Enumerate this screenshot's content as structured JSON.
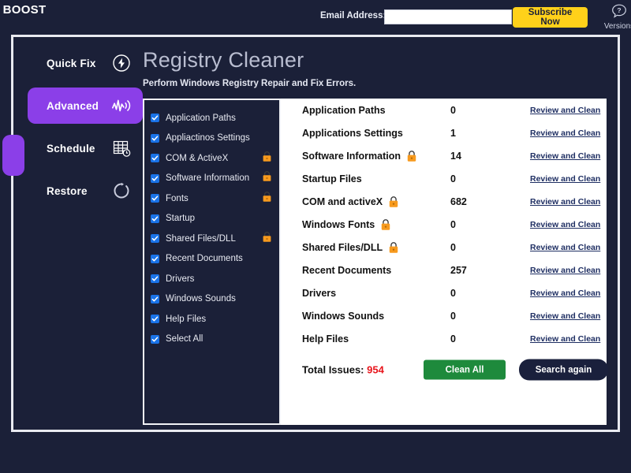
{
  "topbar": {
    "logo": "C BOOST",
    "email_label": "Email Address:",
    "email_value": "",
    "email_placeholder": "",
    "subscribe_label": "Subscribe Now",
    "versions_label": "Versions",
    "help_icon": "question-bubble-icon"
  },
  "sidebar": {
    "items": [
      {
        "label": "Quick Fix",
        "icon": "lightning-circle-icon",
        "active": false
      },
      {
        "label": "Advanced",
        "icon": "pulse-wave-icon",
        "active": true
      },
      {
        "label": "Schedule",
        "icon": "calendar-clock-icon",
        "active": false
      },
      {
        "label": "Restore",
        "icon": "restore-circle-arrow-icon",
        "active": false
      }
    ]
  },
  "header": {
    "title": "Registry Cleaner",
    "subtitle": "Perform Windows Registry Repair and Fix Errors."
  },
  "checklist": [
    {
      "label": "Application Paths",
      "checked": true,
      "locked": false
    },
    {
      "label": "Appliactinos Settings",
      "checked": true,
      "locked": false
    },
    {
      "label": "COM & ActiveX",
      "checked": true,
      "locked": true
    },
    {
      "label": "Software Information",
      "checked": true,
      "locked": true
    },
    {
      "label": "Fonts",
      "checked": true,
      "locked": true
    },
    {
      "label": "Startup",
      "checked": true,
      "locked": false
    },
    {
      "label": "Shared Files/DLL",
      "checked": true,
      "locked": true
    },
    {
      "label": "Recent Documents",
      "checked": true,
      "locked": false
    },
    {
      "label": "Drivers",
      "checked": true,
      "locked": false
    },
    {
      "label": "Windows Sounds",
      "checked": true,
      "locked": false
    },
    {
      "label": "Help Files",
      "checked": true,
      "locked": false
    },
    {
      "label": "Select All",
      "checked": true,
      "locked": false
    }
  ],
  "results": {
    "link_label": "Review and Clean",
    "rows": [
      {
        "name": "Application Paths",
        "count": "0",
        "locked": false
      },
      {
        "name": "Applications Settings",
        "count": "1",
        "locked": false
      },
      {
        "name": "Software Information",
        "count": "14",
        "locked": true
      },
      {
        "name": "Startup Files",
        "count": "0",
        "locked": false
      },
      {
        "name": "COM and activeX",
        "count": "682",
        "locked": true
      },
      {
        "name": "Windows Fonts",
        "count": "0",
        "locked": true
      },
      {
        "name": "Shared Files/DLL",
        "count": "0",
        "locked": true
      },
      {
        "name": "Recent Documents",
        "count": "257",
        "locked": false
      },
      {
        "name": "Drivers",
        "count": "0",
        "locked": false
      },
      {
        "name": "Windows Sounds",
        "count": "0",
        "locked": false
      },
      {
        "name": "Help Files",
        "count": "0",
        "locked": false
      }
    ],
    "total_label": "Total Issues:",
    "total_value": "954",
    "clean_all_label": "Clean All",
    "search_again_label": "Search again"
  },
  "colors": {
    "background": "#1b2038",
    "accent_purple": "#8b3fe8",
    "subscribe_yellow": "#ffd11a",
    "clean_green": "#1e8a3c",
    "search_navy": "#1a203c",
    "total_red": "#e8141b",
    "link_navy": "#1f2f63",
    "lock_orange": "#f79a1e",
    "checkbox_blue": "#1a73e8"
  }
}
